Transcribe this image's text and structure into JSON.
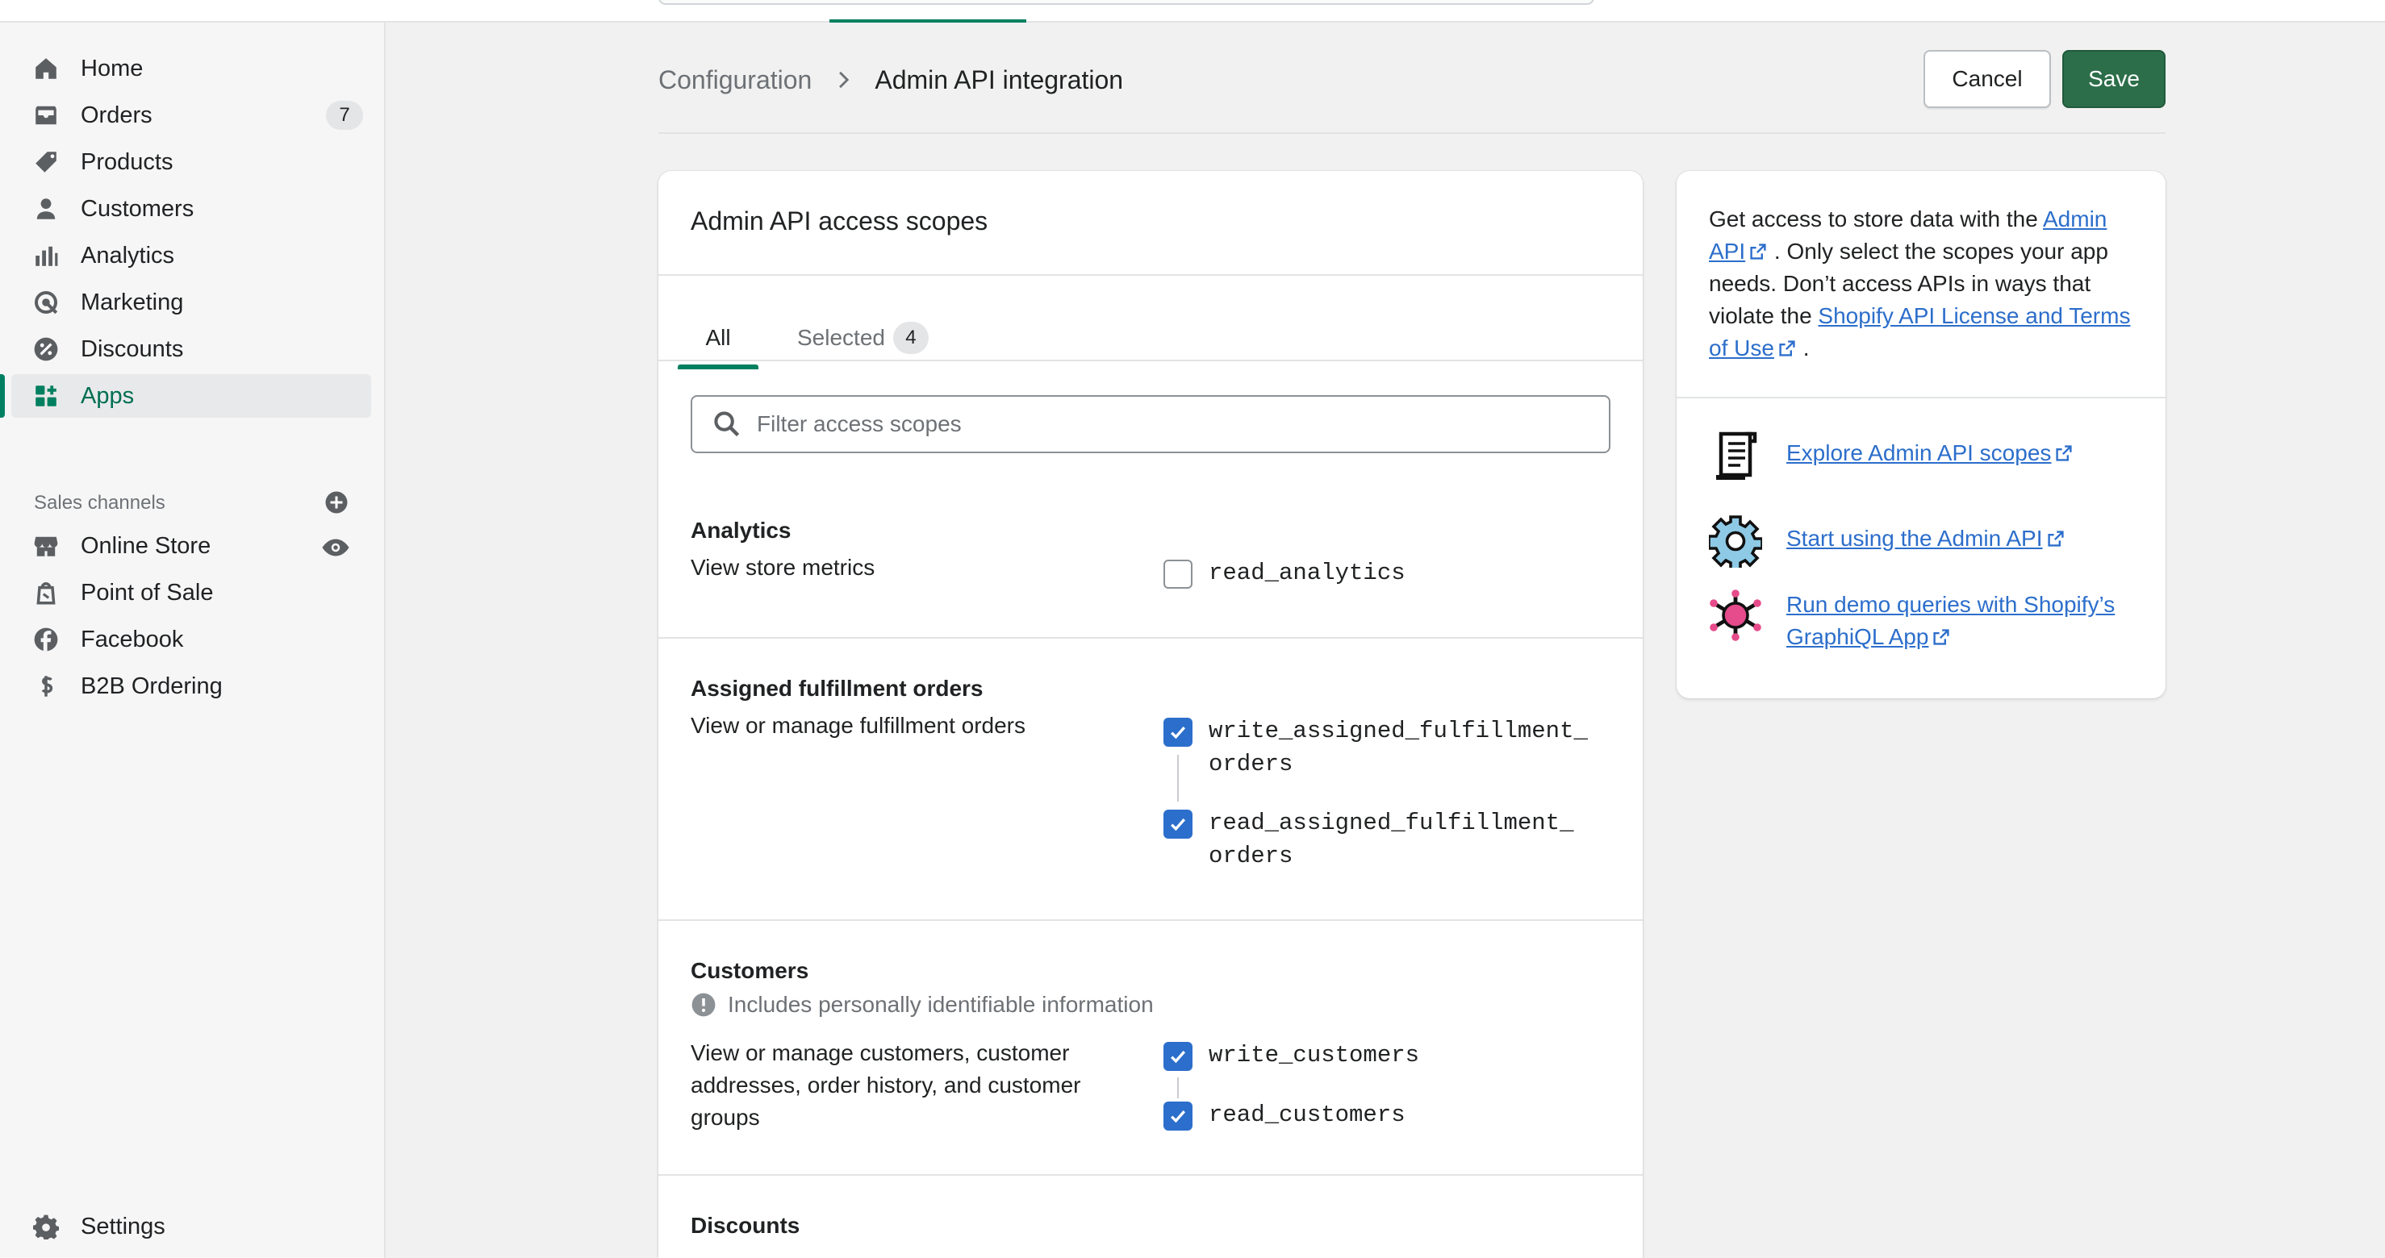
{
  "sidebar": {
    "items": [
      {
        "label": "Home",
        "icon": "home-icon"
      },
      {
        "label": "Orders",
        "icon": "inbox-icon",
        "badge": "7"
      },
      {
        "label": "Products",
        "icon": "tag-icon"
      },
      {
        "label": "Customers",
        "icon": "person-icon"
      },
      {
        "label": "Analytics",
        "icon": "bar-chart-icon"
      },
      {
        "label": "Marketing",
        "icon": "target-icon"
      },
      {
        "label": "Discounts",
        "icon": "discount-icon"
      },
      {
        "label": "Apps",
        "icon": "apps-icon",
        "active": true
      }
    ],
    "sales_channels_heading": "Sales channels",
    "channels": [
      {
        "label": "Online Store",
        "icon": "store-icon"
      },
      {
        "label": "Point of Sale",
        "icon": "bag-icon"
      },
      {
        "label": "Facebook",
        "icon": "facebook-icon"
      },
      {
        "label": "B2B Ordering",
        "icon": "b2b-icon"
      }
    ],
    "settings_label": "Settings"
  },
  "header": {
    "breadcrumb_parent": "Configuration",
    "breadcrumb_current": "Admin API integration",
    "cancel_label": "Cancel",
    "save_label": "Save"
  },
  "scopes_card": {
    "title": "Admin API access scopes",
    "tabs": [
      {
        "label": "All",
        "active": true
      },
      {
        "label": "Selected",
        "count": "4"
      }
    ],
    "filter_placeholder": "Filter access scopes",
    "groups": [
      {
        "title": "Analytics",
        "description": "View store metrics",
        "scopes": [
          {
            "name": "read_analytics",
            "checked": false
          }
        ]
      },
      {
        "title": "Assigned fulfillment orders",
        "description": "View or manage fulfillment orders",
        "scopes": [
          {
            "name": "write_assigned_fulfillment_\norders",
            "checked": true
          },
          {
            "name": "read_assigned_fulfillment_\norders",
            "checked": true
          }
        ]
      },
      {
        "title": "Customers",
        "notice": "Includes personally identifiable information",
        "description": "View or manage customers, customer addresses, order history, and customer groups",
        "scopes": [
          {
            "name": "write_customers",
            "checked": true
          },
          {
            "name": "read_customers",
            "checked": true
          }
        ]
      },
      {
        "title": "Discounts"
      }
    ]
  },
  "info_card": {
    "text_before_link": "Get access to store data with the ",
    "admin_api_link": "Admin API",
    "text_middle": " . Only select the scopes your app needs. Don’t access APIs in ways that violate the ",
    "license_link": "Shopify API License and Terms of Use",
    "text_end": " .",
    "resources": [
      {
        "label": "Explore Admin API scopes",
        "icon": "scroll-icon"
      },
      {
        "label": "Start using the Admin API",
        "icon": "gear-pixel-icon"
      },
      {
        "label": "Run demo queries with Shopify’s GraphiQL App",
        "icon": "bug-pixel-icon"
      }
    ]
  },
  "colors": {
    "accent": "#008060",
    "save_button": "#2c6e49",
    "link": "#2c6ecb",
    "checkbox": "#2c6ecb"
  }
}
